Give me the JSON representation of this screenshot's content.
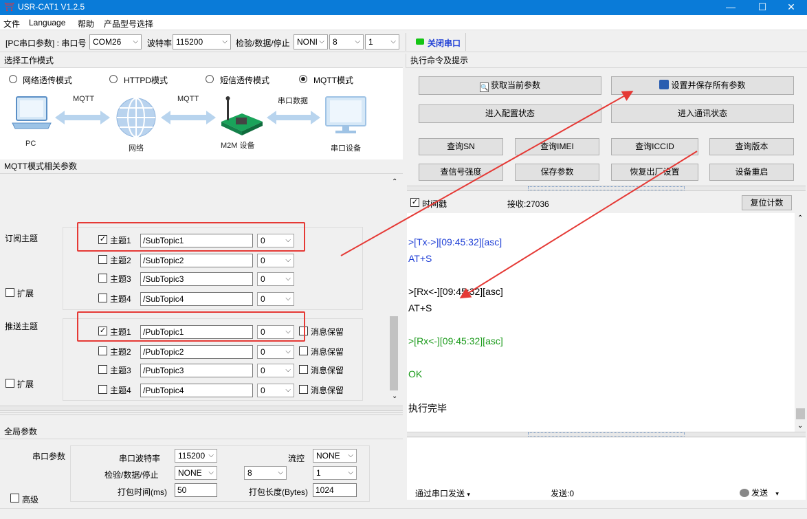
{
  "window": {
    "title": "USR-CAT1 V1.2.5"
  },
  "menu": [
    "文件",
    "Language",
    "帮助",
    "产品型号选择"
  ],
  "toolbar": {
    "pc_serial_label": "[PC串口参数] : 串口号",
    "port": "COM26",
    "baud_label": "波特率",
    "baud": "115200",
    "check_label": "检验/数据/停止",
    "parity": "NONI",
    "databits": "8",
    "stopbits": "1",
    "close_port": "关闭串口"
  },
  "work_mode": {
    "header": "选择工作模式",
    "modes": [
      "网络透传模式",
      "HTTPD模式",
      "短信透传模式",
      "MQTT模式"
    ],
    "selected": "MQTT模式",
    "diagram": {
      "pc": "PC",
      "mqtt1": "MQTT",
      "network": "网络",
      "mqtt2": "MQTT",
      "m2m": "M2M 设备",
      "serial_data": "串口数据",
      "serial_device": "串口设备"
    }
  },
  "mqtt_params": {
    "header": "MQTT模式相关参数",
    "subscribe_label": "订阅主题",
    "publish_label": "推送主题",
    "expand": "扩展",
    "sub_topics": [
      {
        "label": "主题1",
        "value": "/SubTopic1",
        "qos": "0",
        "checked": true
      },
      {
        "label": "主题2",
        "value": "/SubTopic2",
        "qos": "0",
        "checked": false
      },
      {
        "label": "主题3",
        "value": "/SubTopic3",
        "qos": "0",
        "checked": false
      },
      {
        "label": "主题4",
        "value": "/SubTopic4",
        "qos": "0",
        "checked": false
      }
    ],
    "pub_topics": [
      {
        "label": "主题1",
        "value": "/PubTopic1",
        "qos": "0",
        "checked": true,
        "retain": "消息保留"
      },
      {
        "label": "主题2",
        "value": "/PubTopic2",
        "qos": "0",
        "checked": false,
        "retain": "消息保留"
      },
      {
        "label": "主题3",
        "value": "/PubTopic3",
        "qos": "0",
        "checked": false,
        "retain": "消息保留"
      },
      {
        "label": "主题4",
        "value": "/PubTopic4",
        "qos": "0",
        "checked": false,
        "retain": "消息保留"
      }
    ]
  },
  "global_params": {
    "header": "全局参数",
    "serial_params": "串口参数",
    "baud_label": "串口波特率",
    "baud": "115200",
    "flow_label": "流控",
    "flow": "NONE",
    "check_label": "检验/数据/停止",
    "parity": "NONE",
    "databits": "8",
    "stopbits": "1",
    "pack_time_label": "打包时间(ms)",
    "pack_time": "50",
    "pack_len_label": "打包长度(Bytes)",
    "pack_len": "1024",
    "advanced": "高级"
  },
  "commands": {
    "header": "执行命令及提示",
    "get_params": "获取当前参数",
    "save_all": "设置并保存所有参数",
    "enter_config": "进入配置状态",
    "enter_comm": "进入通讯状态",
    "row3": [
      "查询SN",
      "查询IMEI",
      "查询ICCID",
      "查询版本"
    ],
    "row4": [
      "查信号强度",
      "保存参数",
      "恢复出厂设置",
      "设备重启"
    ]
  },
  "log": {
    "timestamp_label": "时间戳",
    "received": "接收:27036",
    "reset_count": "复位计数",
    "lines": [
      {
        "text": ">[Tx->][09:45:32][asc]",
        "color": "#1f3fd6"
      },
      {
        "text": "AT+S",
        "color": "#1f3fd6"
      },
      {
        "text": ">[Rx<-][09:45:32][asc]",
        "color": "#000000"
      },
      {
        "text": "AT+S",
        "color": "#000000"
      },
      {
        "text": ">[Rx<-][09:45:32][asc]",
        "color": "#1a9a1a"
      },
      {
        "text": "OK",
        "color": "#1a9a1a"
      },
      {
        "text": "执行完毕",
        "color": "#000000"
      }
    ]
  },
  "send_bar": {
    "send_via": "通过串口发送",
    "sent": "发送:0",
    "send_button": "发送"
  },
  "colors": {
    "titlebar": "#0a7bd8",
    "annotation": "#e53935",
    "status_green": "#14c514"
  }
}
